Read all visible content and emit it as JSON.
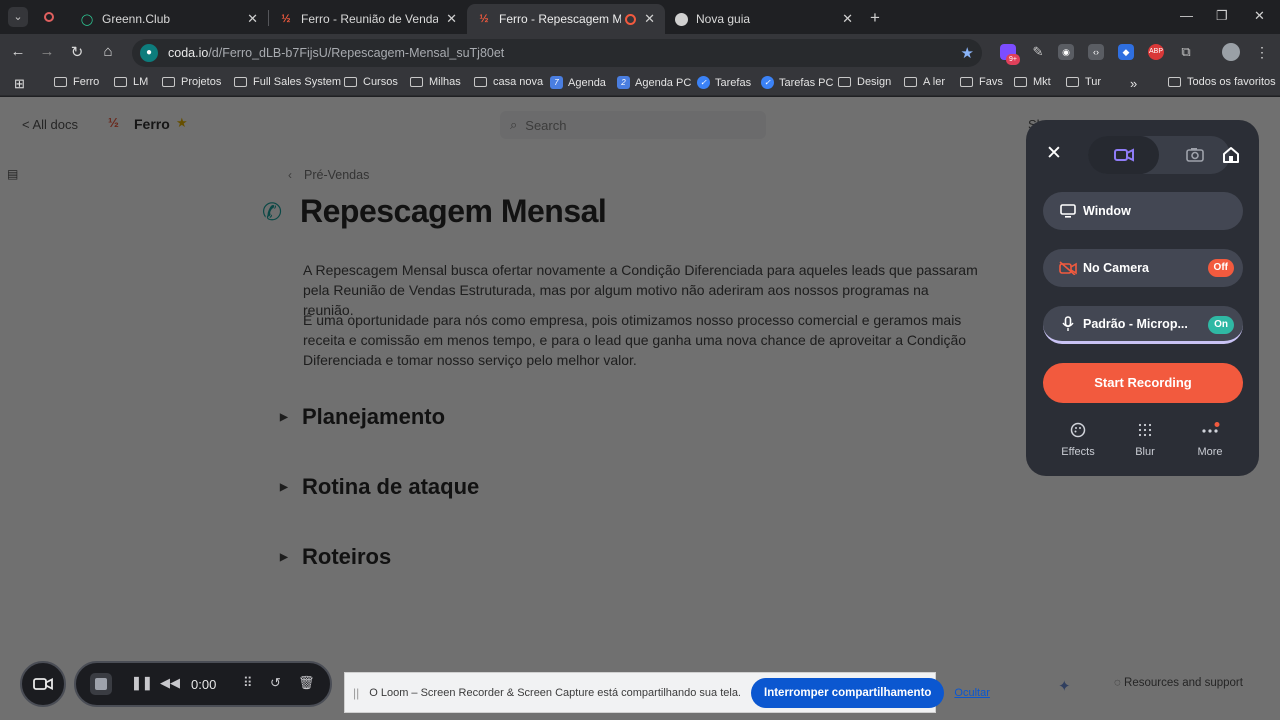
{
  "browser": {
    "tabs": [
      {
        "title": "Greenn.Club",
        "icon": "greenn-icon",
        "active": false
      },
      {
        "title": "Ferro - Reunião de Vendas Estru",
        "icon": "coda-icon",
        "active": false
      },
      {
        "title": "Ferro - Repescagem Mensal",
        "icon": "coda-icon",
        "active": true
      },
      {
        "title": "Nova guia",
        "icon": "chrome-icon",
        "active": false
      }
    ],
    "url_host": "coda.io",
    "url_path": "/d/Ferro_dLB-b7FijsU/Repescagem-Mensal_suTj80et",
    "extension_badge": "9+",
    "bookmarks": [
      "Ferro",
      "LM",
      "Projetos",
      "Full Sales System",
      "Cursos",
      "Milhas",
      "casa nova",
      "Agenda",
      "Agenda PC",
      "Tarefas",
      "Tarefas PC",
      "Design",
      "A ler",
      "Favs",
      "Mkt",
      "Tur"
    ],
    "bookmarks_overflow": "»",
    "all_bookmarks": "Todos os favoritos"
  },
  "page": {
    "all_docs": "< All docs",
    "doc_name": "Ferro",
    "search_placeholder": "Search",
    "header_right": "Sh",
    "breadcrumb": "Pré-Vendas",
    "title": "Repescagem Mensal",
    "paragraphs": [
      "A Repescagem Mensal busca ofertar novamente a Condição Diferenciada para aqueles leads que passaram pela Reunião de Vendas Estruturada, mas por algum motivo não aderiram aos nossos programas na reunião.",
      "É uma oportunidade para nós como empresa, pois otimizamos nosso processo comercial e geramos mais receita e comissão em menos tempo, e para o lead que ganha uma nova chance de aproveitar a Condição Diferenciada e tomar nosso serviço pelo melhor valor."
    ],
    "sections": [
      "Planejamento",
      "Rotina de ataque",
      "Roteiros"
    ],
    "resources": "Resources and support"
  },
  "loom": {
    "window_label": "Window",
    "camera_label": "No Camera",
    "camera_state": "Off",
    "mic_label": "Padrão - Microp...",
    "mic_state": "On",
    "start_label": "Start Recording",
    "effects_label": "Effects",
    "blur_label": "Blur",
    "more_label": "More",
    "accent": "#f25a3e",
    "on_color": "#2fb8a4"
  },
  "recorder": {
    "time": "0:00"
  },
  "share_bar": {
    "message": "O Loom – Screen Recorder & Screen Capture está compartilhando sua tela.",
    "stop_label": "Interromper compartilhamento",
    "hide_label": "Ocultar"
  }
}
